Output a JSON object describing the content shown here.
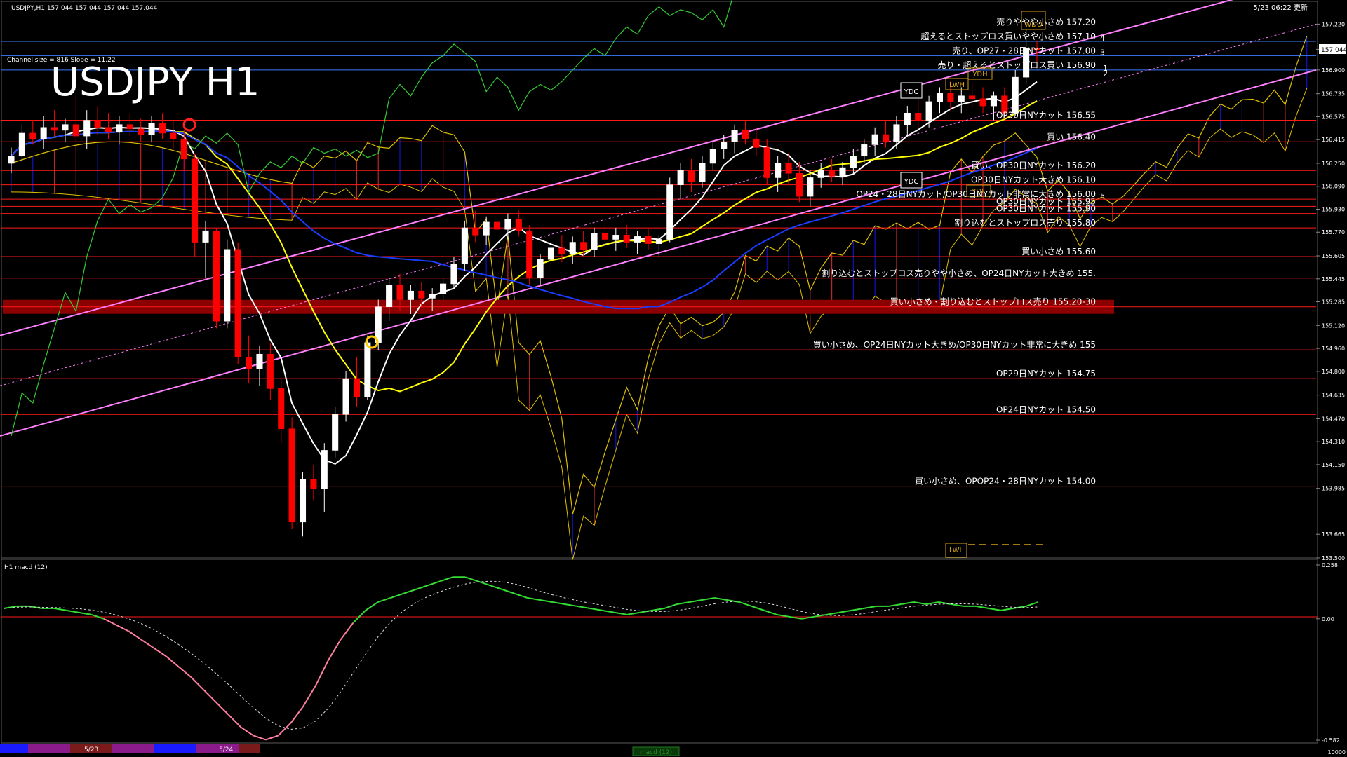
{
  "header": {
    "symbol_info": "USDJPY,H1  157.044 157.044 157.044 157.044",
    "updated": "5/23 06:22 更新",
    "channel_info": "Channel size = 816 Slope = 11.22",
    "big_title": "USDJPY H1"
  },
  "macd_header": "H1  macd (12)",
  "colors": {
    "background": "#000000",
    "bull_candle": "#ffffff",
    "bear_candle": "#ff0000",
    "channel": "#ff7fff",
    "ma_fast": "#ffffff",
    "ma_mid": "#ffff00",
    "ma_slow": "#1a3cff",
    "chikou": "#33cc33",
    "cloud_bull": "#1a1aff",
    "cloud_bear": "#ff3333",
    "level_line": "#ff1a1a",
    "blue_level": "#3b7bff",
    "highlight_band": "#8b0000"
  },
  "price_axis": {
    "ticks": [
      "157.220",
      "157.044",
      "156.900",
      "156.735",
      "156.575",
      "156.415",
      "156.250",
      "156.090",
      "155.930",
      "155.770",
      "155.605",
      "155.445",
      "155.285",
      "155.120",
      "154.960",
      "154.800",
      "154.635",
      "154.470",
      "154.310",
      "154.150",
      "153.985",
      "153.665",
      "153.500"
    ],
    "current_price": "157.044"
  },
  "macd_axis": {
    "ticks": [
      "0.258",
      "0.00",
      "-0.582"
    ]
  },
  "chart_data": {
    "type": "candlestick",
    "symbol": "USDJPY",
    "timeframe": "H1",
    "ylim": [
      153.5,
      157.3
    ],
    "macd_ylim": [
      -0.582,
      0.258
    ],
    "candles": [
      {
        "o": 156.25,
        "h": 156.36,
        "l": 156.18,
        "c": 156.3
      },
      {
        "o": 156.3,
        "h": 156.52,
        "l": 156.26,
        "c": 156.46
      },
      {
        "o": 156.46,
        "h": 156.55,
        "l": 156.38,
        "c": 156.42
      },
      {
        "o": 156.42,
        "h": 156.58,
        "l": 156.35,
        "c": 156.5
      },
      {
        "o": 156.5,
        "h": 156.62,
        "l": 156.44,
        "c": 156.48
      },
      {
        "o": 156.48,
        "h": 156.56,
        "l": 156.4,
        "c": 156.52
      },
      {
        "o": 156.52,
        "h": 156.72,
        "l": 156.4,
        "c": 156.44
      },
      {
        "o": 156.44,
        "h": 156.62,
        "l": 156.35,
        "c": 156.55
      },
      {
        "o": 156.55,
        "h": 156.65,
        "l": 156.45,
        "c": 156.5
      },
      {
        "o": 156.5,
        "h": 156.6,
        "l": 156.42,
        "c": 156.47
      },
      {
        "o": 156.47,
        "h": 156.58,
        "l": 156.38,
        "c": 156.52
      },
      {
        "o": 156.52,
        "h": 156.6,
        "l": 156.44,
        "c": 156.49
      },
      {
        "o": 156.49,
        "h": 156.56,
        "l": 156.4,
        "c": 156.45
      },
      {
        "o": 156.45,
        "h": 156.58,
        "l": 156.4,
        "c": 156.53
      },
      {
        "o": 156.53,
        "h": 156.6,
        "l": 156.42,
        "c": 156.46
      },
      {
        "o": 156.46,
        "h": 156.55,
        "l": 156.35,
        "c": 156.42
      },
      {
        "o": 156.42,
        "h": 156.48,
        "l": 156.2,
        "c": 156.28
      },
      {
        "o": 156.28,
        "h": 156.32,
        "l": 155.6,
        "c": 155.7
      },
      {
        "o": 155.7,
        "h": 155.85,
        "l": 155.45,
        "c": 155.78
      },
      {
        "o": 155.78,
        "h": 155.8,
        "l": 155.1,
        "c": 155.15
      },
      {
        "o": 155.15,
        "h": 155.72,
        "l": 155.1,
        "c": 155.65
      },
      {
        "o": 155.65,
        "h": 155.7,
        "l": 154.85,
        "c": 154.9
      },
      {
        "o": 154.9,
        "h": 155.05,
        "l": 154.72,
        "c": 154.82
      },
      {
        "o": 154.82,
        "h": 154.98,
        "l": 154.7,
        "c": 154.92
      },
      {
        "o": 154.92,
        "h": 155.0,
        "l": 154.6,
        "c": 154.68
      },
      {
        "o": 154.68,
        "h": 154.75,
        "l": 154.3,
        "c": 154.4
      },
      {
        "o": 154.4,
        "h": 154.48,
        "l": 153.7,
        "c": 153.75
      },
      {
        "o": 153.75,
        "h": 154.1,
        "l": 153.65,
        "c": 154.05
      },
      {
        "o": 154.05,
        "h": 154.15,
        "l": 153.9,
        "c": 153.98
      },
      {
        "o": 153.98,
        "h": 154.3,
        "l": 153.82,
        "c": 154.25
      },
      {
        "o": 154.25,
        "h": 154.55,
        "l": 154.2,
        "c": 154.5
      },
      {
        "o": 154.5,
        "h": 154.8,
        "l": 154.45,
        "c": 154.75
      },
      {
        "o": 154.75,
        "h": 154.9,
        "l": 154.55,
        "c": 154.62
      },
      {
        "o": 154.62,
        "h": 155.05,
        "l": 154.6,
        "c": 155.0
      },
      {
        "o": 155.0,
        "h": 155.3,
        "l": 154.95,
        "c": 155.25
      },
      {
        "o": 155.25,
        "h": 155.45,
        "l": 155.15,
        "c": 155.4
      },
      {
        "o": 155.4,
        "h": 155.48,
        "l": 155.22,
        "c": 155.3
      },
      {
        "o": 155.3,
        "h": 155.4,
        "l": 155.2,
        "c": 155.36
      },
      {
        "o": 155.36,
        "h": 155.42,
        "l": 155.25,
        "c": 155.31
      },
      {
        "o": 155.31,
        "h": 155.38,
        "l": 155.22,
        "c": 155.34
      },
      {
        "o": 155.34,
        "h": 155.45,
        "l": 155.3,
        "c": 155.41
      },
      {
        "o": 155.41,
        "h": 155.6,
        "l": 155.38,
        "c": 155.55
      },
      {
        "o": 155.55,
        "h": 155.85,
        "l": 155.5,
        "c": 155.8
      },
      {
        "o": 155.8,
        "h": 155.92,
        "l": 155.7,
        "c": 155.75
      },
      {
        "o": 155.75,
        "h": 155.88,
        "l": 155.68,
        "c": 155.84
      },
      {
        "o": 155.84,
        "h": 155.95,
        "l": 155.76,
        "c": 155.79
      },
      {
        "o": 155.79,
        "h": 155.9,
        "l": 155.72,
        "c": 155.86
      },
      {
        "o": 155.86,
        "h": 155.92,
        "l": 155.74,
        "c": 155.78
      },
      {
        "o": 155.78,
        "h": 155.82,
        "l": 155.4,
        "c": 155.45
      },
      {
        "o": 155.45,
        "h": 155.62,
        "l": 155.4,
        "c": 155.58
      },
      {
        "o": 155.58,
        "h": 155.7,
        "l": 155.5,
        "c": 155.66
      },
      {
        "o": 155.66,
        "h": 155.75,
        "l": 155.56,
        "c": 155.62
      },
      {
        "o": 155.62,
        "h": 155.74,
        "l": 155.55,
        "c": 155.7
      },
      {
        "o": 155.7,
        "h": 155.78,
        "l": 155.6,
        "c": 155.65
      },
      {
        "o": 155.65,
        "h": 155.8,
        "l": 155.6,
        "c": 155.76
      },
      {
        "o": 155.76,
        "h": 155.85,
        "l": 155.66,
        "c": 155.72
      },
      {
        "o": 155.72,
        "h": 155.8,
        "l": 155.64,
        "c": 155.75
      },
      {
        "o": 155.75,
        "h": 155.82,
        "l": 155.66,
        "c": 155.7
      },
      {
        "o": 155.7,
        "h": 155.78,
        "l": 155.62,
        "c": 155.74
      },
      {
        "o": 155.74,
        "h": 155.8,
        "l": 155.65,
        "c": 155.69
      },
      {
        "o": 155.69,
        "h": 155.75,
        "l": 155.6,
        "c": 155.72
      },
      {
        "o": 155.72,
        "h": 156.15,
        "l": 155.7,
        "c": 156.1
      },
      {
        "o": 156.1,
        "h": 156.25,
        "l": 156.0,
        "c": 156.2
      },
      {
        "o": 156.2,
        "h": 156.28,
        "l": 156.05,
        "c": 156.12
      },
      {
        "o": 156.12,
        "h": 156.3,
        "l": 156.08,
        "c": 156.25
      },
      {
        "o": 156.25,
        "h": 156.4,
        "l": 156.2,
        "c": 156.35
      },
      {
        "o": 156.35,
        "h": 156.45,
        "l": 156.28,
        "c": 156.4
      },
      {
        "o": 156.4,
        "h": 156.52,
        "l": 156.32,
        "c": 156.48
      },
      {
        "o": 156.48,
        "h": 156.55,
        "l": 156.38,
        "c": 156.42
      },
      {
        "o": 156.42,
        "h": 156.5,
        "l": 156.3,
        "c": 156.36
      },
      {
        "o": 156.36,
        "h": 156.42,
        "l": 156.1,
        "c": 156.15
      },
      {
        "o": 156.15,
        "h": 156.3,
        "l": 156.05,
        "c": 156.25
      },
      {
        "o": 156.25,
        "h": 156.32,
        "l": 156.1,
        "c": 156.18
      },
      {
        "o": 156.18,
        "h": 156.26,
        "l": 155.98,
        "c": 156.02
      },
      {
        "o": 156.02,
        "h": 156.2,
        "l": 155.95,
        "c": 156.15
      },
      {
        "o": 156.15,
        "h": 156.25,
        "l": 156.08,
        "c": 156.2
      },
      {
        "o": 156.2,
        "h": 156.28,
        "l": 156.12,
        "c": 156.16
      },
      {
        "o": 156.16,
        "h": 156.26,
        "l": 156.1,
        "c": 156.22
      },
      {
        "o": 156.22,
        "h": 156.35,
        "l": 156.18,
        "c": 156.3
      },
      {
        "o": 156.3,
        "h": 156.42,
        "l": 156.25,
        "c": 156.38
      },
      {
        "o": 156.38,
        "h": 156.5,
        "l": 156.3,
        "c": 156.45
      },
      {
        "o": 156.45,
        "h": 156.55,
        "l": 156.36,
        "c": 156.4
      },
      {
        "o": 156.4,
        "h": 156.58,
        "l": 156.35,
        "c": 156.52
      },
      {
        "o": 156.52,
        "h": 156.65,
        "l": 156.45,
        "c": 156.6
      },
      {
        "o": 156.6,
        "h": 156.7,
        "l": 156.5,
        "c": 156.55
      },
      {
        "o": 156.55,
        "h": 156.72,
        "l": 156.5,
        "c": 156.68
      },
      {
        "o": 156.68,
        "h": 156.78,
        "l": 156.6,
        "c": 156.74
      },
      {
        "o": 156.74,
        "h": 156.82,
        "l": 156.62,
        "c": 156.68
      },
      {
        "o": 156.68,
        "h": 156.78,
        "l": 156.6,
        "c": 156.72
      },
      {
        "o": 156.72,
        "h": 156.8,
        "l": 156.64,
        "c": 156.7
      },
      {
        "o": 156.7,
        "h": 156.78,
        "l": 156.6,
        "c": 156.65
      },
      {
        "o": 156.65,
        "h": 156.75,
        "l": 156.55,
        "c": 156.72
      },
      {
        "o": 156.72,
        "h": 156.78,
        "l": 156.56,
        "c": 156.6
      },
      {
        "o": 156.6,
        "h": 156.9,
        "l": 156.58,
        "c": 156.85
      },
      {
        "o": 156.85,
        "h": 157.18,
        "l": 156.8,
        "c": 157.05
      },
      {
        "o": 157.05,
        "h": 157.1,
        "l": 156.95,
        "c": 157.04
      }
    ],
    "macd": [
      0.05,
      0.06,
      0.06,
      0.05,
      0.05,
      0.04,
      0.03,
      0.02,
      0.0,
      -0.03,
      -0.06,
      -0.1,
      -0.14,
      -0.18,
      -0.23,
      -0.28,
      -0.34,
      -0.4,
      -0.46,
      -0.52,
      -0.56,
      -0.58,
      -0.56,
      -0.5,
      -0.42,
      -0.32,
      -0.2,
      -0.1,
      -0.02,
      0.04,
      0.08,
      0.1,
      0.12,
      0.14,
      0.16,
      0.18,
      0.2,
      0.2,
      0.18,
      0.16,
      0.14,
      0.12,
      0.1,
      0.09,
      0.08,
      0.07,
      0.06,
      0.05,
      0.04,
      0.03,
      0.02,
      0.03,
      0.04,
      0.05,
      0.07,
      0.08,
      0.09,
      0.1,
      0.09,
      0.08,
      0.06,
      0.04,
      0.02,
      0.01,
      0.0,
      0.01,
      0.02,
      0.03,
      0.04,
      0.05,
      0.06,
      0.06,
      0.07,
      0.08,
      0.07,
      0.08,
      0.07,
      0.06,
      0.06,
      0.05,
      0.04,
      0.05,
      0.06,
      0.08
    ]
  },
  "levels": [
    {
      "price": 157.2,
      "label": "売りややや小さめ 157.20",
      "color": "#3b7bff"
    },
    {
      "price": 157.1,
      "label": "超えるとストップロス買いやや小さめ 157.10",
      "color": "#3b7bff",
      "num": "4"
    },
    {
      "price": 157.0,
      "label": "売り、OP27・28日NYカット 157.00",
      "color": "#3b7bff",
      "num": "3"
    },
    {
      "price": 156.9,
      "label": "売り・超えるとストップロス買い 156.90",
      "color": "#3b7bff"
    },
    {
      "price": 156.55,
      "label": "OP30日NYカット 156.55",
      "color": "#ff1a1a"
    },
    {
      "price": 156.4,
      "label": "買い 156.40",
      "color": "#ff1a1a"
    },
    {
      "price": 156.2,
      "label": "買い、OP30日NYカット 156.20",
      "color": "#ff1a1a"
    },
    {
      "price": 156.1,
      "label": "OP30日NYカット大きめ 156.10",
      "color": "#ff1a1a"
    },
    {
      "price": 156.0,
      "label": "OP24・28日NYカット/OP30日NYカット非常に大きめ 156.00",
      "color": "#ff1a1a",
      "num": "5"
    },
    {
      "price": 155.95,
      "label": "OP30日NYカット 155.95",
      "color": "#ff1a1a"
    },
    {
      "price": 155.9,
      "label": "OP30日NYカット 155.90",
      "color": "#ff1a1a"
    },
    {
      "price": 155.8,
      "label": "割り込むとストップロス売り 155.80",
      "color": "#ff1a1a"
    },
    {
      "price": 155.6,
      "label": "買い小さめ 155.60",
      "color": "#ff1a1a"
    },
    {
      "price": 155.45,
      "label": "割り込むとストップロス売りやや小さめ、OP24日NYカット大きめ 155.",
      "color": "#ff1a1a"
    },
    {
      "price": 155.25,
      "label": "買い小さめ・割り込むとストップロス売り 155.20-30",
      "color": "#ff1a1a",
      "band": true
    },
    {
      "price": 154.95,
      "label": "買い小さめ、OP24日NYカット大きめ/OP30日NYカット非常に大きめ 155",
      "color": "#ff1a1a"
    },
    {
      "price": 154.75,
      "label": "OP29日NYカット 154.75",
      "color": "#ff1a1a"
    },
    {
      "price": 154.5,
      "label": "OP24日NYカット 154.50",
      "color": "#ff1a1a"
    },
    {
      "price": 154.0,
      "label": "買い小さめ、OPOP24・28日NYカット 154.00",
      "color": "#ff1a1a"
    }
  ],
  "markers": {
    "ydc_top": "YDC",
    "ydc_mid": "YDC",
    "ydh": "YDH",
    "lwh": "LWH",
    "wdo": "WDO",
    "ydl": "YDL",
    "lwl": "LWL",
    "num1": "1",
    "num2": "2"
  },
  "timeline": {
    "labels": [
      "5/23",
      "5/24"
    ],
    "indicator_tab": "macd (12)",
    "corner_value": "10000"
  }
}
